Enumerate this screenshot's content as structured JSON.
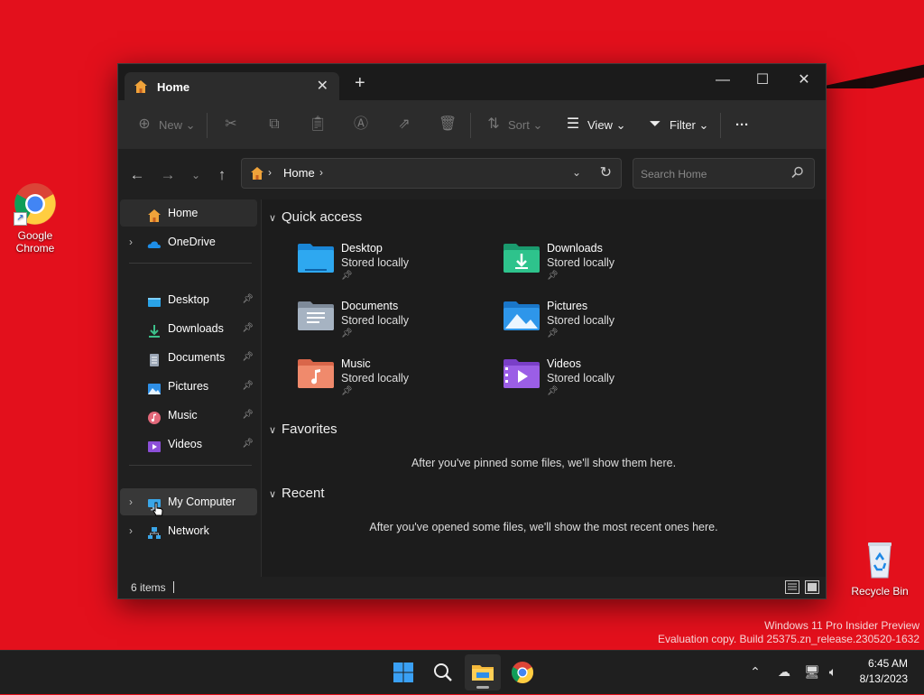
{
  "desktop": {
    "icons": [
      {
        "label_line1": "Google",
        "label_line2": "Chrome",
        "icon": "chrome-icon"
      },
      {
        "label_line1": "Recycle Bin",
        "icon": "recycle-bin-icon"
      }
    ]
  },
  "window": {
    "tab_title": "Home",
    "toolbar": {
      "new_label": "New",
      "sort_label": "Sort",
      "view_label": "View",
      "filter_label": "Filter",
      "more_label": "···"
    },
    "address": {
      "location": "Home"
    },
    "search": {
      "placeholder": "Search Home"
    },
    "sidebar": {
      "home": "Home",
      "onedrive": "OneDrive",
      "pinned": [
        "Desktop",
        "Downloads",
        "Documents",
        "Pictures",
        "Music",
        "Videos"
      ],
      "my_computer": "My Computer",
      "network": "Network"
    },
    "content": {
      "quick_access_title": "Quick access",
      "quick_access": [
        {
          "name": "Desktop",
          "status": "Stored locally"
        },
        {
          "name": "Downloads",
          "status": "Stored locally"
        },
        {
          "name": "Documents",
          "status": "Stored locally"
        },
        {
          "name": "Pictures",
          "status": "Stored locally"
        },
        {
          "name": "Music",
          "status": "Stored locally"
        },
        {
          "name": "Videos",
          "status": "Stored locally"
        }
      ],
      "favorites_title": "Favorites",
      "favorites_empty": "After you've pinned some files, we'll show them here.",
      "recent_title": "Recent",
      "recent_empty": "After you've opened some files, we'll show the most recent ones here."
    },
    "status": {
      "item_count": "6 items"
    }
  },
  "watermark": {
    "line1": "Windows 11 Pro Insider Preview",
    "line2": "Evaluation copy. Build 25375.zn_release.230520-1632"
  },
  "taskbar": {
    "time": "6:45 AM",
    "date": "8/13/2023"
  },
  "colors": {
    "desktop": "#e3101c",
    "window_bg": "#202020",
    "accent": "#0a84ff"
  }
}
